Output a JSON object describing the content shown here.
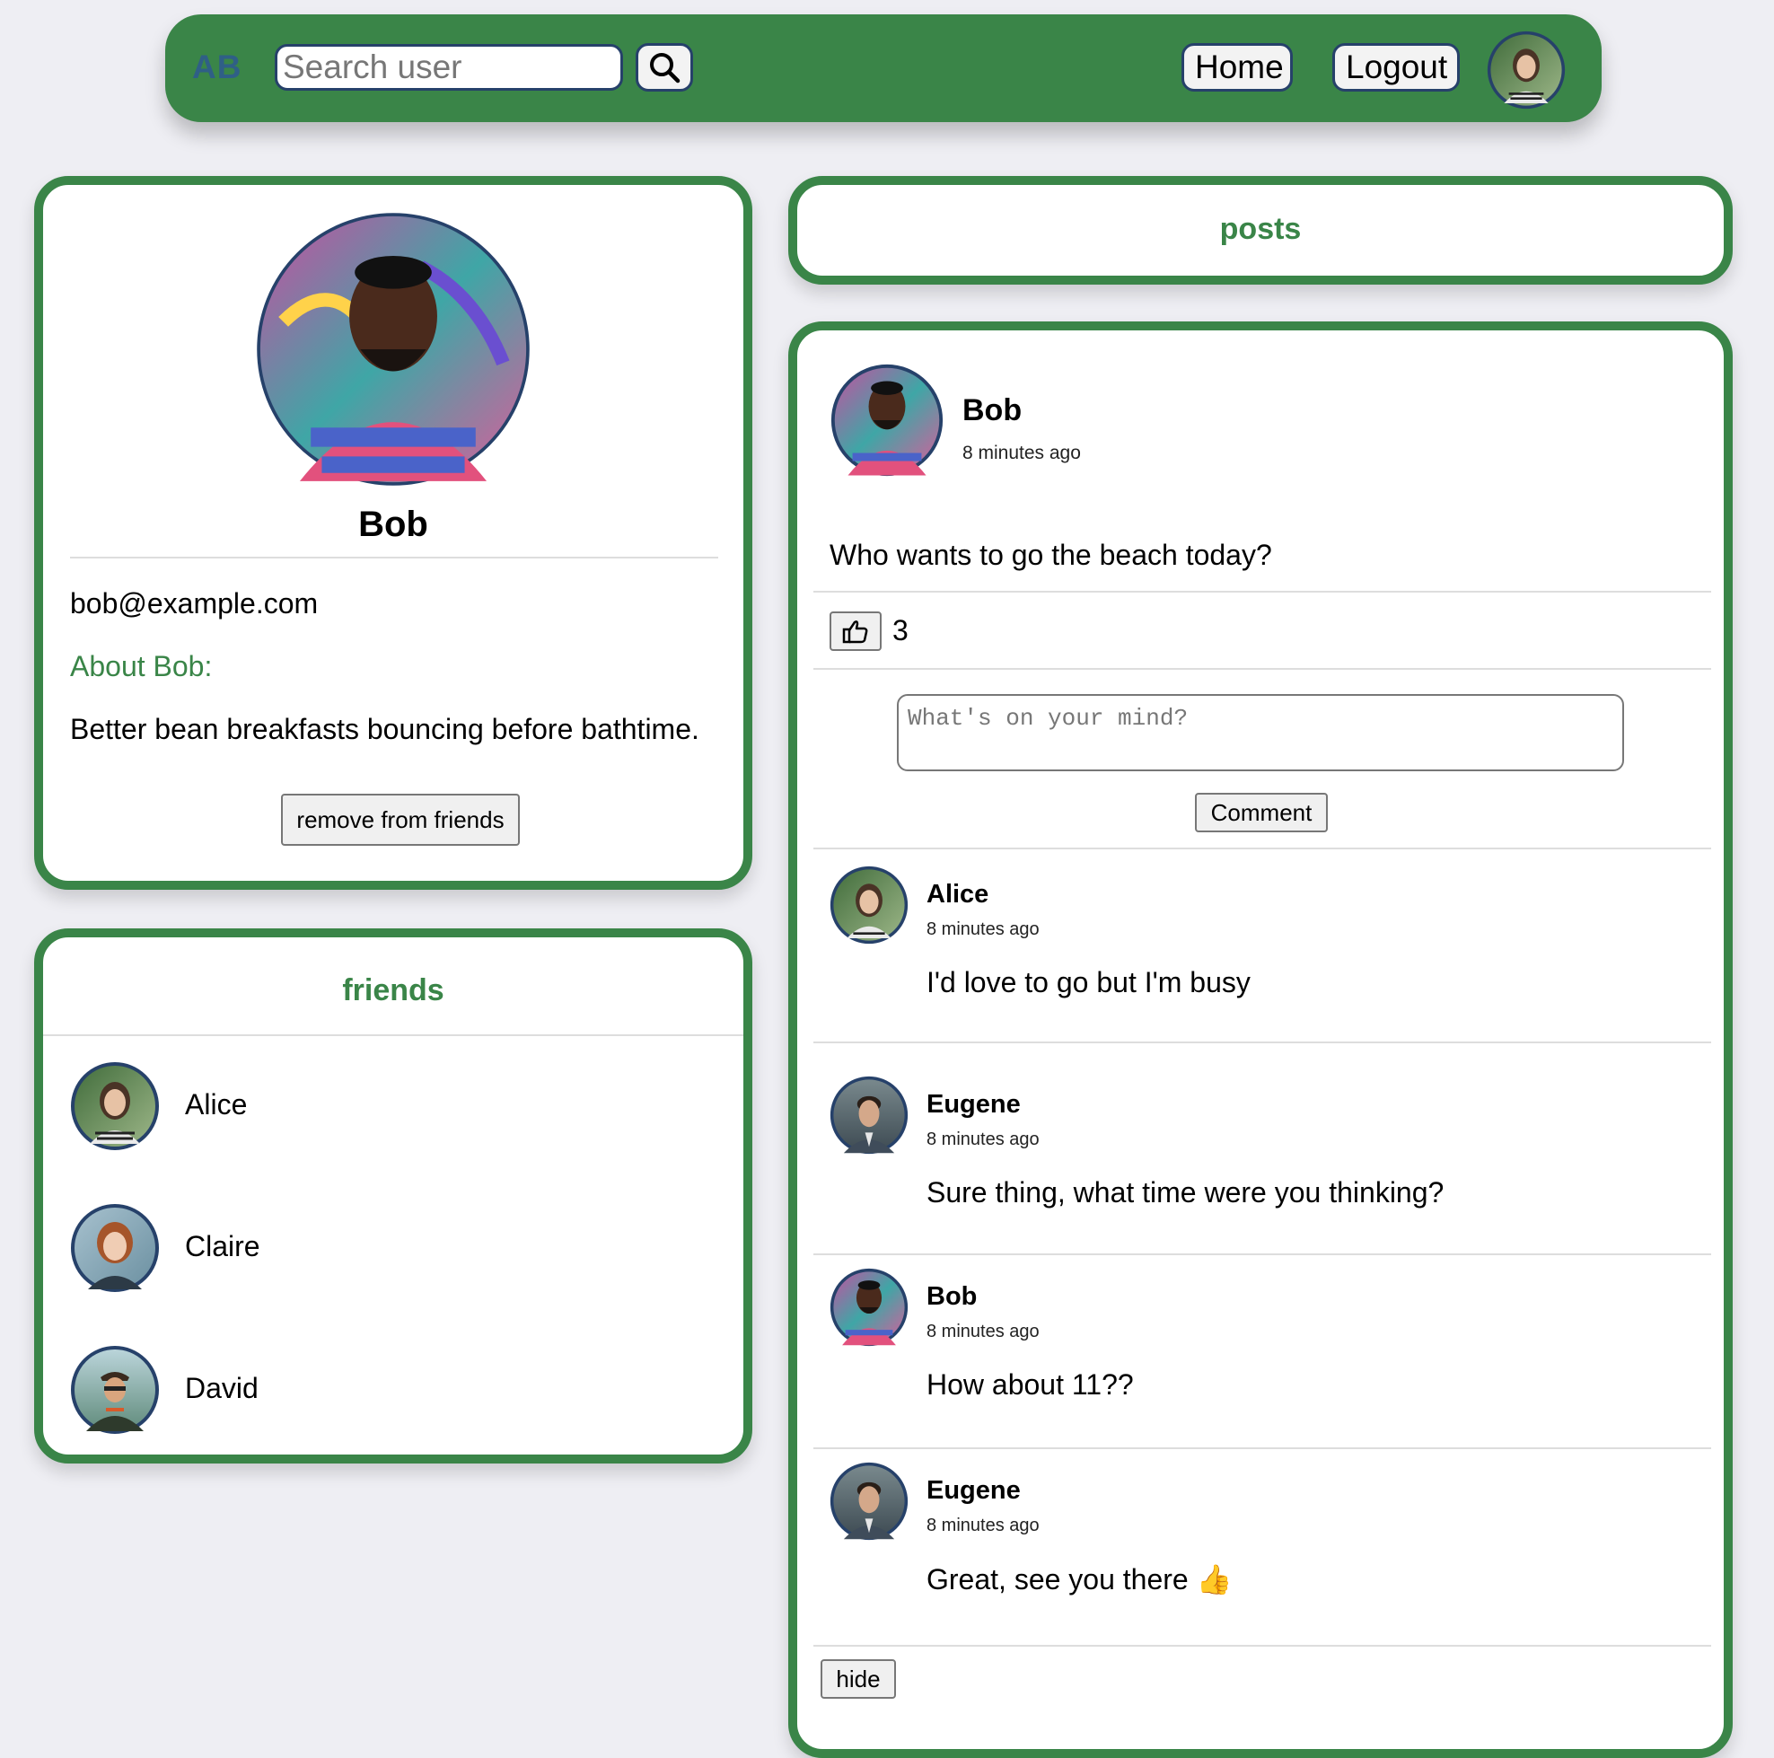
{
  "navbar": {
    "logo": "AB",
    "search_placeholder": "Search user",
    "search_value": "",
    "home_label": "Home",
    "logout_label": "Logout",
    "search_icon": "search-icon",
    "accent_color": "#3a8548"
  },
  "profile": {
    "name": "Bob",
    "email": "bob@example.com",
    "about_label": "About Bob:",
    "about_text": "Better bean breakfasts bouncing before bathtime.",
    "remove_button": "remove from friends"
  },
  "friends": {
    "title": "friends",
    "items": [
      {
        "name": "Alice"
      },
      {
        "name": "Claire"
      },
      {
        "name": "David"
      }
    ]
  },
  "posts": {
    "title": "posts",
    "post": {
      "author": "Bob",
      "time": "8 minutes ago",
      "text": "Who wants to go the beach today?",
      "like_icon": "thumbs-up-icon",
      "likes": "3",
      "comment_placeholder": "What's on your mind?",
      "comment_button": "Comment",
      "comments": [
        {
          "author": "Alice",
          "time": "8 minutes ago",
          "text": "I'd love to go but I'm busy"
        },
        {
          "author": "Eugene",
          "time": "8 minutes ago",
          "text": "Sure thing, what time were you thinking?"
        },
        {
          "author": "Bob",
          "time": "8 minutes ago",
          "text": "How about 11??"
        },
        {
          "author": "Eugene",
          "time": "8 minutes ago",
          "text": "Great, see you there 👍"
        }
      ],
      "hide_button": "hide"
    }
  }
}
